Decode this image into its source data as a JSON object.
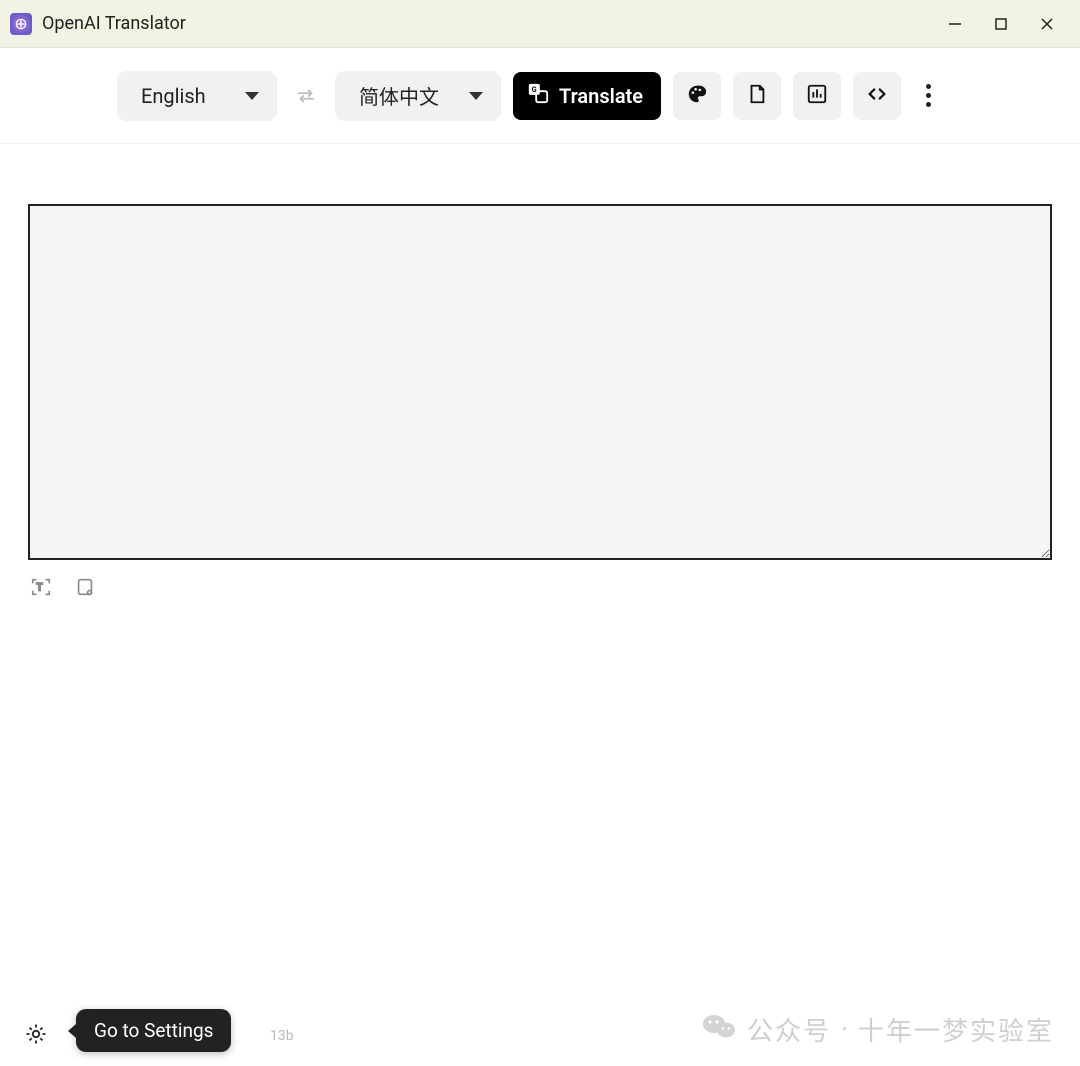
{
  "window": {
    "title": "OpenAI Translator"
  },
  "toolbar": {
    "source_lang": "English",
    "target_lang": "简体中文",
    "translate_label": "Translate"
  },
  "input": {
    "value": "",
    "placeholder": ""
  },
  "tooltip": {
    "settings": "Go to Settings"
  },
  "footer": {
    "trailing": "13b"
  },
  "watermark": {
    "prefix": "公众号",
    "separator": "·",
    "suffix": "十年一梦实验室"
  },
  "colors": {
    "titlebar_bg": "#f3f3e3",
    "btn_bg": "#f1f1f1",
    "primary": "#000000"
  }
}
